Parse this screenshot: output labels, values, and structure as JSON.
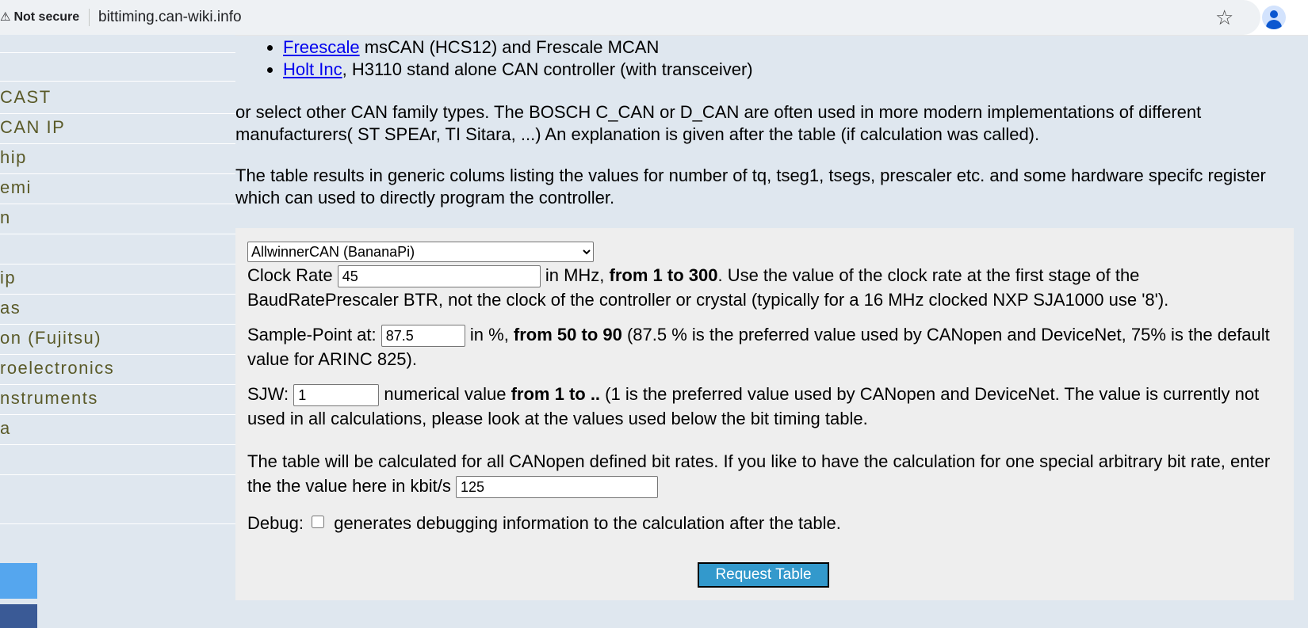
{
  "browser": {
    "security_label": "Not secure",
    "url": "bittiming.can-wiki.info"
  },
  "sidebar": {
    "items": [
      {
        "label": "CAST"
      },
      {
        "label": " CAN IP"
      },
      {
        "label": "hip"
      },
      {
        "label": "emi"
      },
      {
        "label": "n"
      },
      {
        "label": ""
      },
      {
        "label": "ip"
      },
      {
        "label": "as"
      },
      {
        "label": "on (Fujitsu)"
      },
      {
        "label": "roelectronics"
      },
      {
        "label": "nstruments"
      },
      {
        "label": "a"
      }
    ]
  },
  "vendors": [
    {
      "link": "Freescale",
      "text": " msCAN (HCS12) and Frescale MCAN"
    },
    {
      "link": "Holt Inc",
      "text": ", H3110 stand alone CAN controller (with transceiver)"
    }
  ],
  "intro": {
    "p1": "or select other CAN family types. The BOSCH C_CAN or D_CAN are often used in more modern implementations of different manufacturers( ST SPEAr, TI Sitara, ...) An explanation is given after the table (if calculation was called).",
    "p2": "The table results in generic colums listing the values for number of tq, tseg1, tsegs, prescaler etc. and some hardware specifc register which can used to directly program the controller."
  },
  "form": {
    "controller_select": "AllwinnerCAN (BananaPi)",
    "clock": {
      "label": "Clock Rate",
      "value": "45",
      "unit": " in MHz, ",
      "range": "from 1 to 300",
      "note": ". Use the value of the clock rate at the first stage of the BaudRatePrescaler BTR, not the clock of the controller or crystal (typically for a 16 MHz clocked NXP SJA1000 use '8')."
    },
    "sample_point": {
      "label": "Sample-Point at:",
      "value": "87.5",
      "unit": " in %, ",
      "range": "from 50 to 90",
      "note": " (87.5 % is the preferred value used by CANopen and DeviceNet, 75% is the default value for ARINC 825)."
    },
    "sjw": {
      "label": "SJW:",
      "value": "1",
      "unit": " numerical value ",
      "range": "from 1 to ..",
      "note": " (1 is the preferred value used by CANopen and DeviceNet. The value is currently not used in all calculations, please look at the values used below the bit timing table."
    },
    "bitrate": {
      "text": "The table will be calculated for all CANopen defined bit rates. If you like to have the calculation for one special arbitrary bit rate, enter the the value here in kbit/s",
      "value": "125"
    },
    "debug": {
      "label": "Debug:",
      "text": " generates debugging information to the calculation after the table."
    },
    "submit_label": "Request Table"
  }
}
